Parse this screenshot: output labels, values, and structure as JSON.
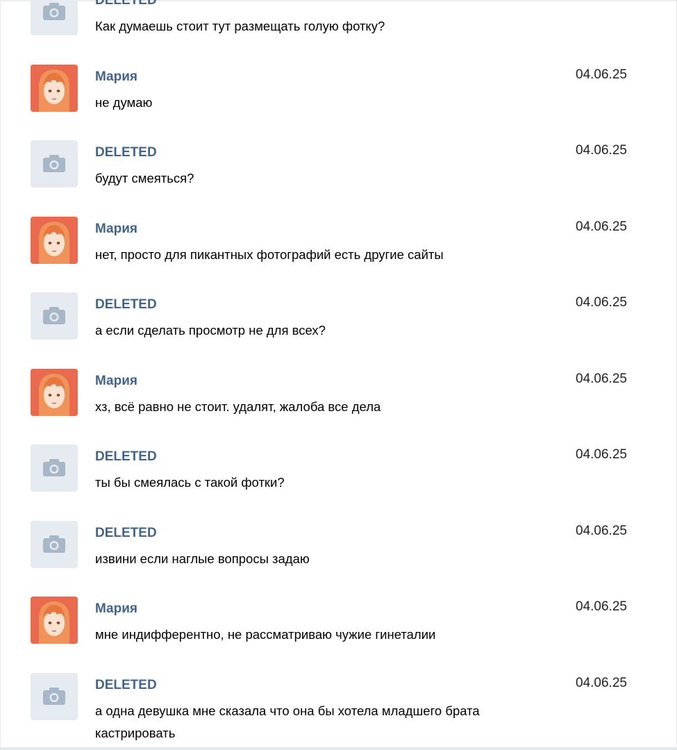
{
  "messages": [
    {
      "author": "DELETED",
      "avatar": "camera-placeholder-icon",
      "date": "",
      "text": "Как думаешь стоит тут размещать голую фотку?"
    },
    {
      "author": "Мария",
      "avatar": "anime-girl-avatar",
      "date": "04.06.25",
      "text": "не думаю"
    },
    {
      "author": "DELETED",
      "avatar": "camera-placeholder-icon",
      "date": "04.06.25",
      "text": "будут смеяться?"
    },
    {
      "author": "Мария",
      "avatar": "anime-girl-avatar",
      "date": "04.06.25",
      "text": "нет, просто для пикантных фотографий есть другие сайты"
    },
    {
      "author": "DELETED",
      "avatar": "camera-placeholder-icon",
      "date": "04.06.25",
      "text": "а если сделать просмотр не для всех?"
    },
    {
      "author": "Мария",
      "avatar": "anime-girl-avatar",
      "date": "04.06.25",
      "text": "хз, всё равно не стоит. удалят, жалоба все дела"
    },
    {
      "author": "DELETED",
      "avatar": "camera-placeholder-icon",
      "date": "04.06.25",
      "text": "ты бы смеялась с такой фотки?"
    },
    {
      "author": "DELETED",
      "avatar": "camera-placeholder-icon",
      "date": "04.06.25",
      "text": "извини если наглые вопросы задаю"
    },
    {
      "author": "Мария",
      "avatar": "anime-girl-avatar",
      "date": "04.06.25",
      "text": "мне индифферентно, не рассматриваю чужие гинеталии"
    },
    {
      "author": "DELETED",
      "avatar": "camera-placeholder-icon",
      "date": "04.06.25",
      "text": "а одна девушка мне сказала что она бы хотела младшего брата кастрировать"
    }
  ],
  "colors": {
    "author_link": "#42648b",
    "text": "#000000",
    "date": "#222222",
    "deleted_avatar_bg": "#e5ebf1",
    "maria_avatar_bg": "#ea6a4f"
  }
}
